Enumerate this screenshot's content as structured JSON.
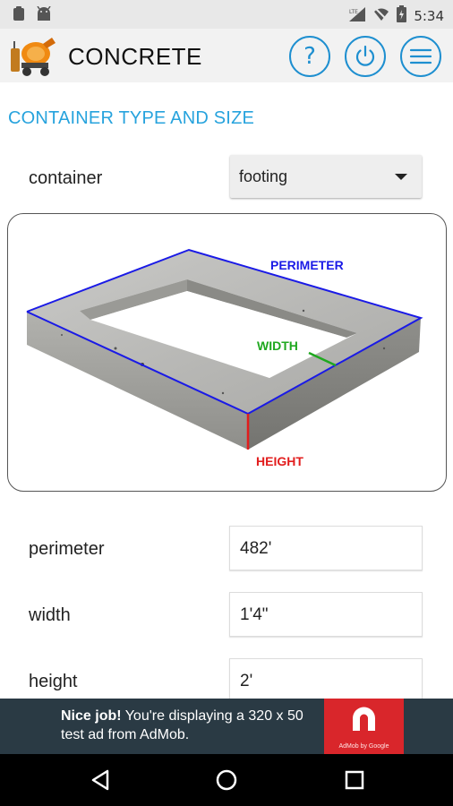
{
  "status_bar": {
    "time": "5:34",
    "network": "LTE"
  },
  "app_bar": {
    "title": "CONCRETE",
    "help_label": "?"
  },
  "section": {
    "title": "CONTAINER TYPE AND SIZE"
  },
  "container": {
    "label": "container",
    "selected": "footing"
  },
  "diagram": {
    "perimeter_label": "PERIMETER",
    "width_label": "WIDTH",
    "height_label": "HEIGHT",
    "colors": {
      "perimeter": "#1a1ae6",
      "width": "#1fa81f",
      "height": "#e21d1d"
    }
  },
  "fields": {
    "perimeter": {
      "label": "perimeter",
      "value": "482'"
    },
    "width": {
      "label": "width",
      "value": "1'4\""
    },
    "height": {
      "label": "height",
      "value": "2'"
    }
  },
  "ad": {
    "headline": "Nice job!",
    "body": " You're displaying a 320 x 50 test ad from AdMob.",
    "logo_caption": "AdMob by Google"
  },
  "theme": {
    "accent": "#27a3dd",
    "button_blue": "#1e8fd0",
    "ad_background": "#2a3a44",
    "ad_logo": "#d9262b"
  }
}
